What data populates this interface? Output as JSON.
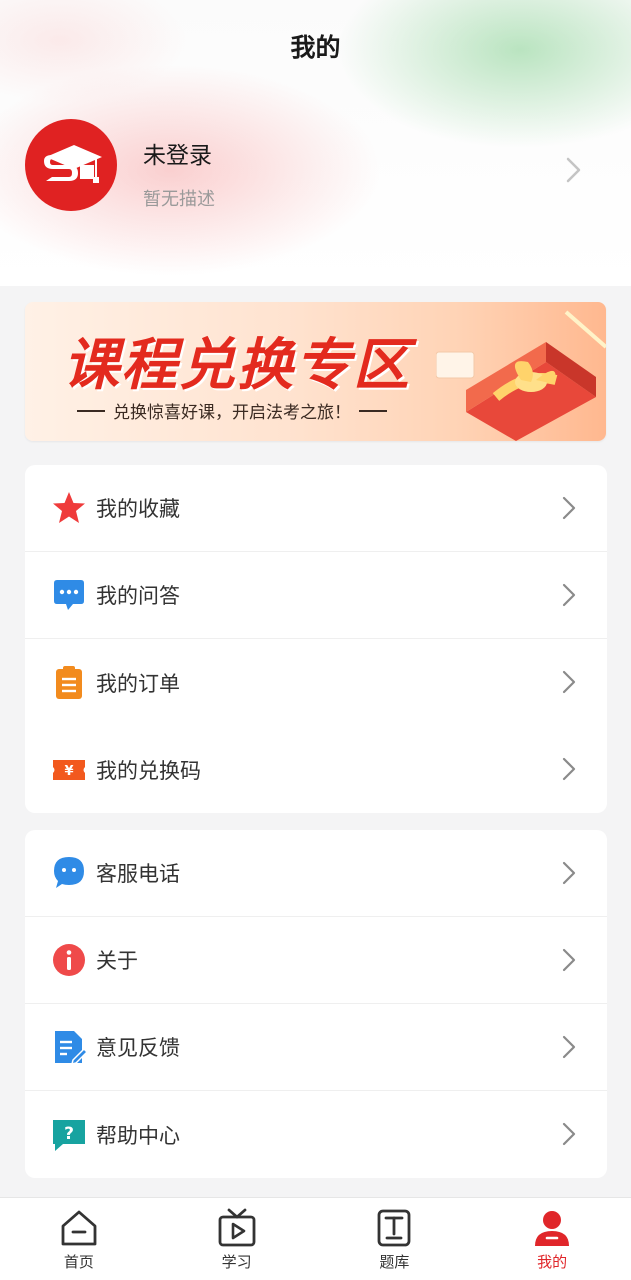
{
  "header": {
    "title": "我的"
  },
  "profile": {
    "name": "未登录",
    "description": "暂无描述"
  },
  "banner": {
    "title": "课程兑换专区",
    "subtitle": "兑换惊喜好课，开启法考之旅！"
  },
  "menu_group_1": [
    {
      "label": "我的收藏",
      "icon": "star-icon"
    },
    {
      "label": "我的问答",
      "icon": "chat-bubble-icon"
    },
    {
      "label": "我的订单",
      "icon": "clipboard-icon"
    },
    {
      "label": "我的兑换码",
      "icon": "yen-ticket-icon"
    }
  ],
  "menu_group_2": [
    {
      "label": "客服电话",
      "icon": "customer-service-icon"
    },
    {
      "label": "关于",
      "icon": "info-icon"
    },
    {
      "label": "意见反馈",
      "icon": "feedback-doc-icon"
    },
    {
      "label": "帮助中心",
      "icon": "help-icon"
    }
  ],
  "tabbar": [
    {
      "label": "首页",
      "icon": "home-icon"
    },
    {
      "label": "学习",
      "icon": "tv-play-icon"
    },
    {
      "label": "题库",
      "icon": "question-bank-icon"
    },
    {
      "label": "我的",
      "icon": "user-icon",
      "active": true
    }
  ],
  "colors": {
    "brand_red": "#e02222",
    "active_tab": "#e0262a",
    "background": "#f4f4f5"
  }
}
